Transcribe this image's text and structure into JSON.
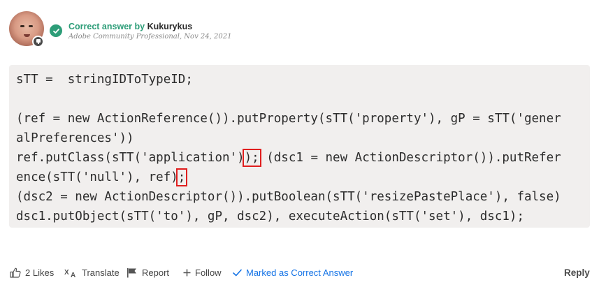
{
  "post": {
    "correct_label": "Correct answer by",
    "author": "Kukurykus",
    "role": "Adobe Community Professional",
    "date": ", Nov 24, 2021"
  },
  "code": {
    "lines": [
      "sTT =  stringIDToTypeID;",
      "",
      "(ref = new ActionReference()).putProperty(sTT('property'), gP = sTT('gener",
      "alPreferences'))",
      [
        "ref.putClass(sTT('application')",
        ");",
        " (dsc1 = new ActionDescriptor()).putRefer"
      ],
      [
        "ence(sTT('null'), ref)",
        ";",
        ""
      ],
      "(dsc2 = new ActionDescriptor()).putBoolean(sTT('resizePastePlace'), false)",
      "dsc1.putObject(sTT('to'), gP, dsc2), executeAction(sTT('set'), dsc1);"
    ]
  },
  "actions": {
    "likes": "2 Likes",
    "translate": "Translate",
    "report": "Report",
    "follow": "Follow",
    "marked": "Marked as Correct Answer",
    "reply": "Reply"
  },
  "icons": {
    "like": "thumbs-up-icon",
    "translate": "translate-icon",
    "report": "flag-icon",
    "follow": "plus-icon",
    "marked": "checkmark-icon",
    "verified": "check-circle-icon"
  },
  "colors": {
    "accent_green": "#2d9d78",
    "link_blue": "#1473e6",
    "code_bg": "#f1efee",
    "highlight_red": "#e01e1e"
  }
}
